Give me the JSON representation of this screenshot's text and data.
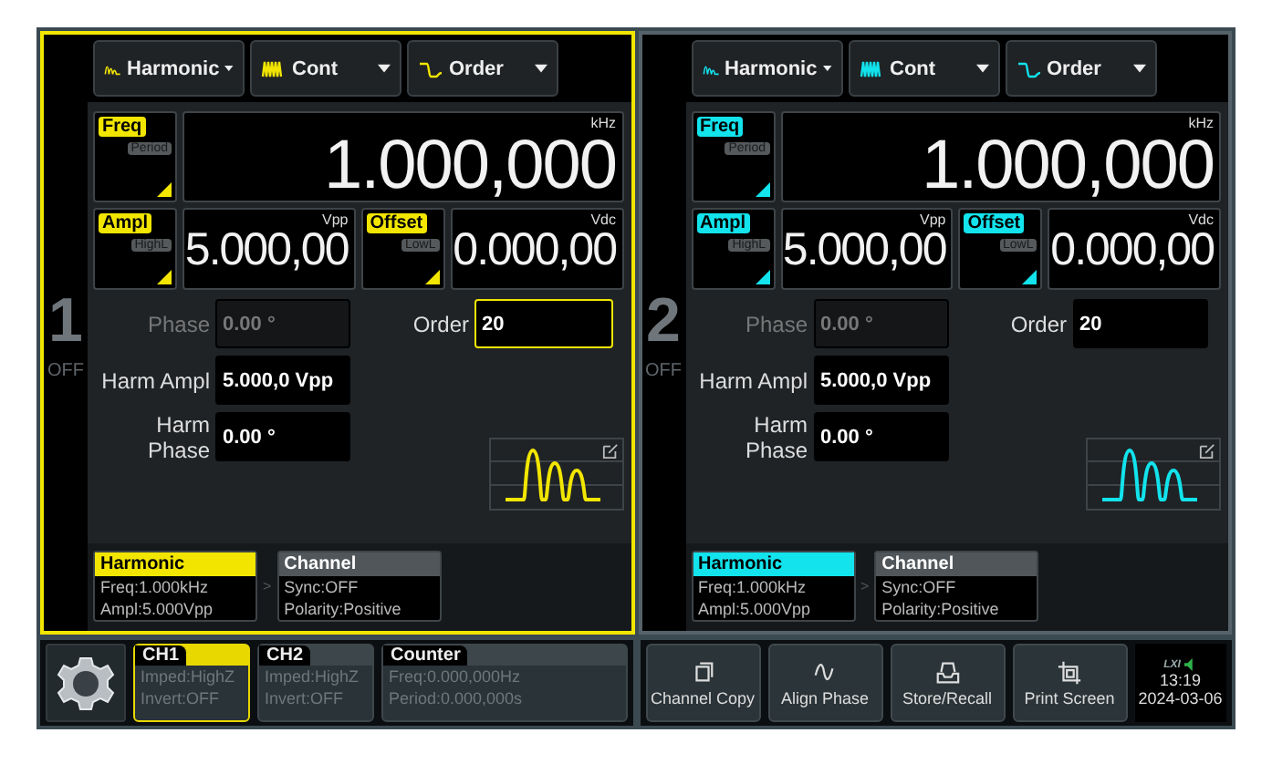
{
  "channels": [
    {
      "number": "1",
      "output": "OFF",
      "selected": true,
      "color": "#f2e600",
      "dropdowns": [
        {
          "label": "Harmonic"
        },
        {
          "label": "Cont"
        },
        {
          "label": "Order"
        }
      ],
      "freq": {
        "label": "Freq",
        "alt_label": "Period",
        "value": "1.000,000",
        "unit": "kHz"
      },
      "ampl": {
        "label": "Ampl",
        "alt_label": "HighL",
        "value": "5.000,00",
        "unit": "Vpp"
      },
      "offset": {
        "label": "Offset",
        "alt_label": "LowL",
        "value": "0.000,00",
        "unit": "Vdc"
      },
      "phase": {
        "label": "Phase",
        "value": "0.00 °",
        "disabled": true
      },
      "order": {
        "label": "Order",
        "value": "20",
        "selected": true
      },
      "harm_ampl": {
        "label": "Harm Ampl",
        "value": "5.000,0 Vpp"
      },
      "harm_phase": {
        "label": "Harm Phase",
        "value": "0.00 °"
      },
      "cards": [
        {
          "title": "Harmonic",
          "lines": [
            "Freq:1.000kHz",
            "Ampl:5.000Vpp"
          ],
          "selected": true
        },
        {
          "title": "Channel",
          "lines": [
            "Sync:OFF",
            "Polarity:Positive"
          ],
          "selected": false
        }
      ],
      "card_separator": ">"
    },
    {
      "number": "2",
      "output": "OFF",
      "selected": false,
      "color": "#12e3ec",
      "dropdowns": [
        {
          "label": "Harmonic"
        },
        {
          "label": "Cont"
        },
        {
          "label": "Order"
        }
      ],
      "freq": {
        "label": "Freq",
        "alt_label": "Period",
        "value": "1.000,000",
        "unit": "kHz"
      },
      "ampl": {
        "label": "Ampl",
        "alt_label": "HighL",
        "value": "5.000,00",
        "unit": "Vpp"
      },
      "offset": {
        "label": "Offset",
        "alt_label": "LowL",
        "value": "0.000,00",
        "unit": "Vdc"
      },
      "phase": {
        "label": "Phase",
        "value": "0.00 °",
        "disabled": true
      },
      "order": {
        "label": "Order",
        "value": "20",
        "selected": false
      },
      "harm_ampl": {
        "label": "Harm Ampl",
        "value": "5.000,0 Vpp"
      },
      "harm_phase": {
        "label": "Harm Phase",
        "value": "0.00 °"
      },
      "cards": [
        {
          "title": "Harmonic",
          "lines": [
            "Freq:1.000kHz",
            "Ampl:5.000Vpp"
          ],
          "selected": true
        },
        {
          "title": "Channel",
          "lines": [
            "Sync:OFF",
            "Polarity:Positive"
          ],
          "selected": false
        }
      ],
      "card_separator": ">"
    }
  ],
  "outputs": [
    {
      "name": "CH1",
      "lines": [
        "Imped:HighZ",
        "Invert:OFF"
      ],
      "selected": true
    },
    {
      "name": "CH2",
      "lines": [
        "Imped:HighZ",
        "Invert:OFF"
      ],
      "selected": false
    }
  ],
  "counter": {
    "title": "Counter",
    "lines": [
      "Freq:0.000,000Hz",
      "Period:0.000,000s"
    ]
  },
  "actions": [
    {
      "label": "Channel Copy"
    },
    {
      "label": "Align Phase"
    },
    {
      "label": "Store/Recall"
    },
    {
      "label": "Print Screen"
    }
  ],
  "status": {
    "lxi": "LXI",
    "time": "13:19",
    "date": "2024-03-06"
  }
}
